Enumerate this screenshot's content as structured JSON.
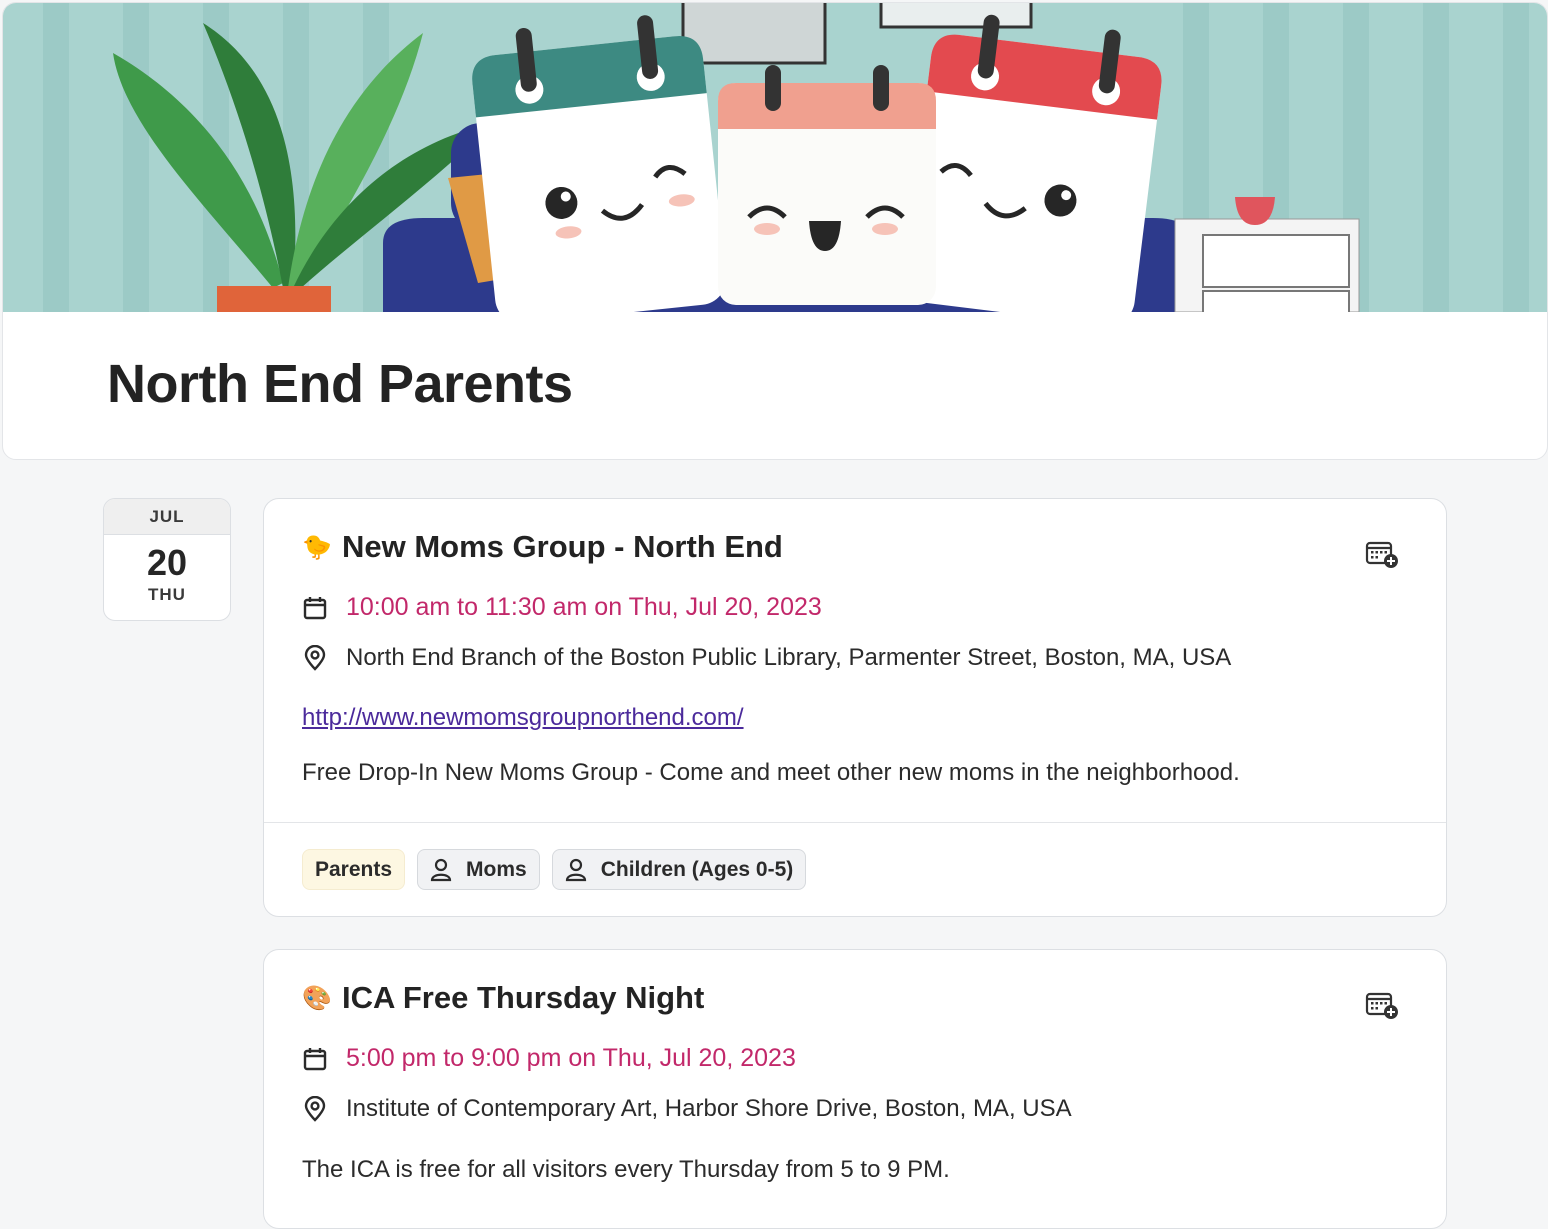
{
  "group": {
    "title": "North End Parents"
  },
  "date_badge": {
    "month": "JUL",
    "day": "20",
    "weekday": "THU"
  },
  "events": [
    {
      "emoji": "🐤",
      "title": "New Moms Group - North End",
      "time": "10:00 am to 11:30 am on Thu, Jul 20, 2023",
      "location": "North End Branch of the Boston Public Library, Parmenter Street, Boston, MA, USA",
      "link": "http://www.newmomsgroupnorthend.com/",
      "description": "Free Drop-In New Moms Group - Come and meet other new moms in the neighborhood.",
      "category_tag": "Parents",
      "audience_tags": [
        "Moms",
        "Children (Ages 0-5)"
      ]
    },
    {
      "emoji": "🎨",
      "title": "ICA Free Thursday Night",
      "time": "5:00 pm to 9:00 pm on Thu, Jul 20, 2023",
      "location": "Institute of Contemporary Art, Harbor Shore Drive, Boston, MA, USA",
      "description": "The ICA is free for all visitors every Thursday from 5 to 9 PM."
    }
  ],
  "icons": {
    "time": "calendar-icon",
    "location": "map-pin-icon",
    "add_to_calendar": "calendar-add-icon",
    "audience": "person-icon"
  },
  "colors": {
    "time_text": "#c2286a",
    "link": "#4b2a9b",
    "category_tag_bg": "#fdf7e2",
    "audience_tag_bg": "#f1f2f4"
  }
}
